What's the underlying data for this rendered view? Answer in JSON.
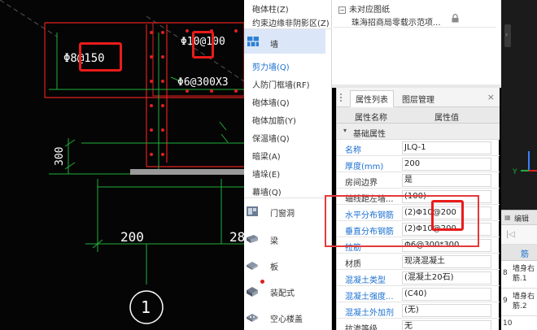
{
  "cad": {
    "rebar_label_1": "Φ8@150",
    "rebar_label_2": "Φ10@100",
    "rebar_label_3": "Φ6@300X3",
    "dim_300": "300",
    "dim_200": "200",
    "dim_2": "28",
    "axis_label": "1"
  },
  "toolpanel": {
    "items_top": [
      "砲体柱(Z)",
      "约束边缘非阴影区(Z)"
    ],
    "wall_category": "墙",
    "wall_items": [
      {
        "label": "剪力墙(Q)",
        "blue": true
      },
      {
        "label": "人防门框墙(RF)",
        "blue": false
      },
      {
        "label": "砲体墙(Q)",
        "blue": false
      },
      {
        "label": "砲体加筋(Y)",
        "blue": false
      },
      {
        "label": "保温墙(Q)",
        "blue": false
      },
      {
        "label": "暗梁(A)",
        "blue": false
      },
      {
        "label": "墙垛(E)",
        "blue": false
      },
      {
        "label": "幕墙(Q)",
        "blue": false
      }
    ],
    "categories": [
      "门窗洞",
      "梁",
      "板",
      "装配式",
      "空心楼盖"
    ]
  },
  "tree": {
    "node_label": "未对应图纸",
    "child_label": "珠海招商局零载示范项..."
  },
  "props": {
    "tab_active": "属性列表",
    "tab_other": "图层管理",
    "col_name": "属性名称",
    "col_value": "属性值",
    "group": "基础属性",
    "rows": [
      {
        "name": "名称",
        "value": "JLQ-1",
        "blue": true
      },
      {
        "name": "厚度(mm)",
        "value": "200",
        "blue": true
      },
      {
        "name": "房间边界",
        "value": "是",
        "blue": false
      },
      {
        "name": "轴线距左墙...",
        "value": "(100)",
        "blue": false
      },
      {
        "name": "水平分布钢筋",
        "value": "(2)Φ10@200",
        "blue": true
      },
      {
        "name": "垂直分布钢筋",
        "value": "(2)Φ10@200",
        "blue": true
      },
      {
        "name": "拉筋",
        "value": "Φ6@300*300",
        "blue": true
      },
      {
        "name": "材质",
        "value": "现浇混凝土",
        "blue": false
      },
      {
        "name": "混凝土类型",
        "value": "(混凝土20石)",
        "blue": true
      },
      {
        "name": "混凝土强度...",
        "value": "(C40)",
        "blue": true
      },
      {
        "name": "混凝土外加剂",
        "value": "(无)",
        "blue": true
      },
      {
        "name": "抗渗等级",
        "value": "无",
        "blue": false
      }
    ]
  },
  "edit_panel": {
    "title": "编辑",
    "col": "筋",
    "row8_num": "8",
    "row8_text": "墙身右筋.1",
    "row9_num": "9",
    "row9_text": "墙身右筋.2",
    "row10_num": "10"
  },
  "colors": {
    "accent_blue": "#1a6fd1",
    "highlight_red": "#ea1b1b",
    "cad_red": "#e02020",
    "cad_green": "#1fae3a"
  }
}
